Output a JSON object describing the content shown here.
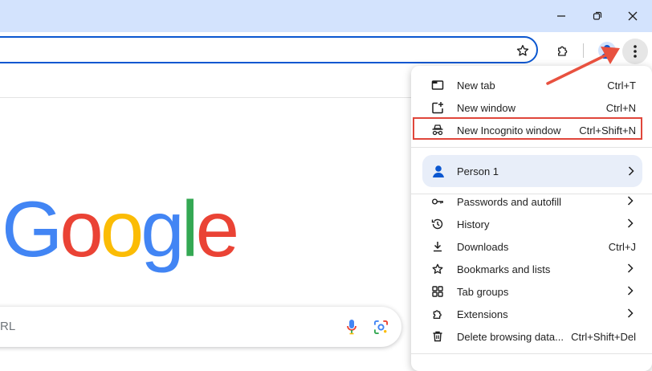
{
  "window": {
    "minimize_icon": "minimize-icon",
    "restore_icon": "restore-icon",
    "close_icon": "close-icon"
  },
  "toolbar": {
    "address_value": "",
    "icons": [
      "star-icon",
      "extensions-icon",
      "profile-avatar",
      "more-menu-icon"
    ]
  },
  "page": {
    "logo_letters": [
      "G",
      "o",
      "o",
      "g",
      "l",
      "e"
    ],
    "logo_colors": [
      "#4285f4",
      "#ea4335",
      "#fbbc05",
      "#4285f4",
      "#34a853",
      "#ea4335"
    ],
    "search_placeholder_fragment": "RL"
  },
  "menu": {
    "items_top": [
      {
        "label": "New tab",
        "shortcut": "Ctrl+T",
        "icon": "new-tab-icon"
      },
      {
        "label": "New window",
        "shortcut": "Ctrl+N",
        "icon": "new-window-icon"
      },
      {
        "label": "New Incognito window",
        "shortcut": "Ctrl+Shift+N",
        "icon": "incognito-icon"
      }
    ],
    "profile": {
      "label": "Person 1",
      "icon": "person-icon"
    },
    "items_bottom": [
      {
        "label": "Passwords and autofill",
        "shortcut": "",
        "icon": "key-icon",
        "submenu": true
      },
      {
        "label": "History",
        "shortcut": "",
        "icon": "history-icon",
        "submenu": true
      },
      {
        "label": "Downloads",
        "shortcut": "Ctrl+J",
        "icon": "download-icon",
        "submenu": false
      },
      {
        "label": "Bookmarks and lists",
        "shortcut": "",
        "icon": "star-icon",
        "submenu": true
      },
      {
        "label": "Tab groups",
        "shortcut": "",
        "icon": "tab-groups-icon",
        "submenu": true
      },
      {
        "label": "Extensions",
        "shortcut": "",
        "icon": "extensions-icon",
        "submenu": true
      },
      {
        "label": "Delete browsing data...",
        "shortcut": "Ctrl+Shift+Del",
        "icon": "trash-icon",
        "submenu": false
      }
    ]
  },
  "annotation": {
    "arrow_color": "#e8513f",
    "highlight_color": "#e0463b"
  }
}
